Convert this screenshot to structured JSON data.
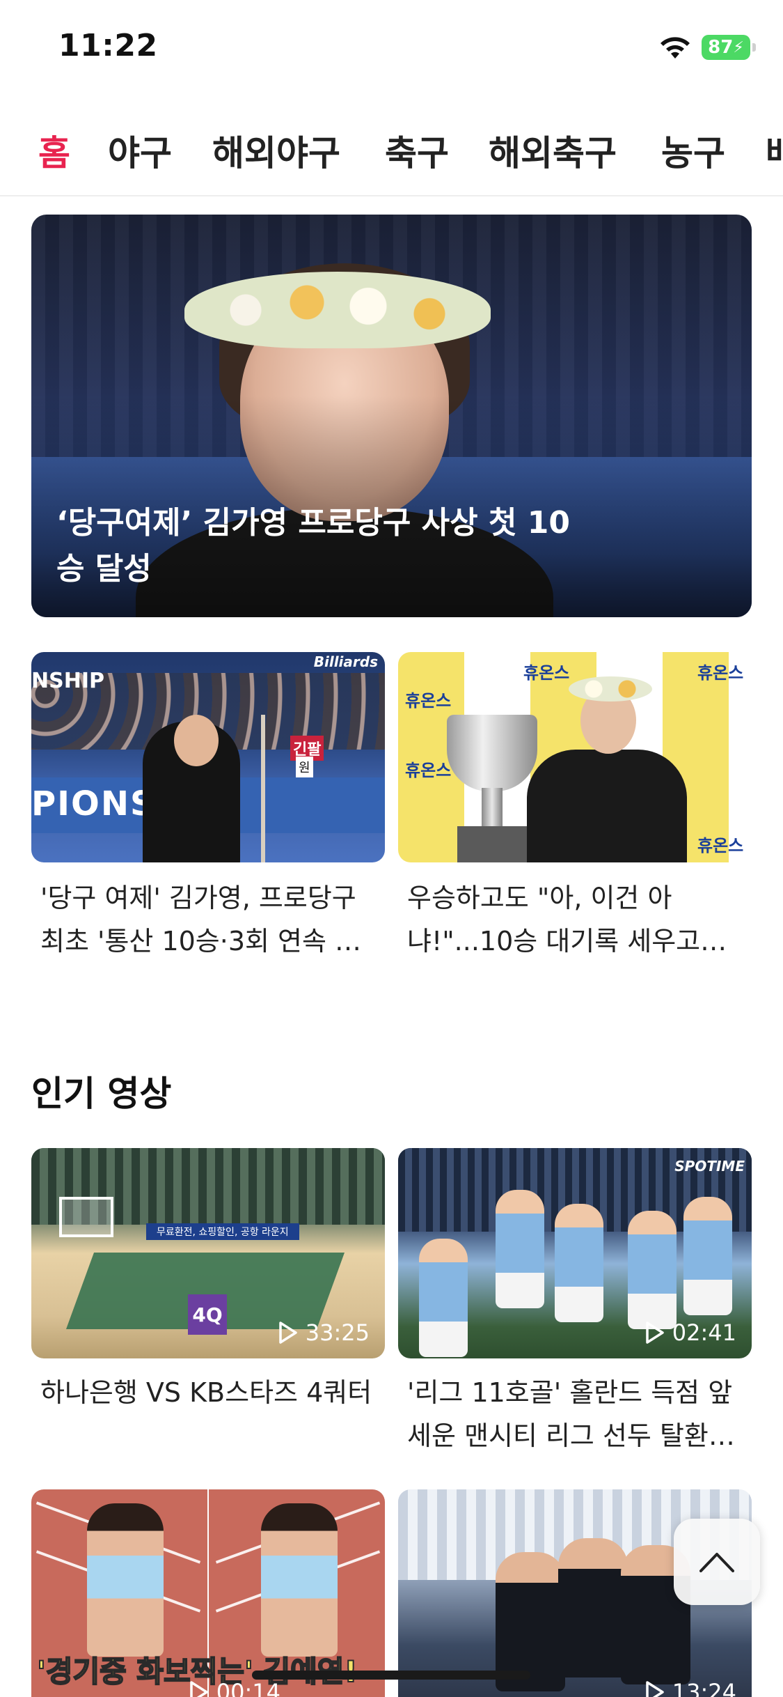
{
  "status_bar": {
    "time": "11:22",
    "battery": "87"
  },
  "tabs": [
    {
      "label": "홈",
      "active": true
    },
    {
      "label": "야구",
      "active": false
    },
    {
      "label": "해외야구",
      "active": false
    },
    {
      "label": "축구",
      "active": false
    },
    {
      "label": "해외축구",
      "active": false
    },
    {
      "label": "농구",
      "active": false
    },
    {
      "label": "배",
      "active": false
    }
  ],
  "colors": {
    "accent": "#e8234f"
  },
  "hero": {
    "title": "‘당구여제’ 김가영 프로당구 사상 첫 10승 달성"
  },
  "news": [
    {
      "title": "'당구 여제' 김가영, 프로당구 최초 '통산 10승·3회 연속 …",
      "thumb_texts": {
        "logo": "Billiards",
        "banner": "PIONSHI",
        "banner_top": "NSHIP",
        "sign": "긴팔",
        "sign2": "원"
      }
    },
    {
      "title": "우승하고도 \"아, 이건 아냐!\"...10승 대기록 세우고…",
      "thumb_texts": {
        "sponsor": "휴온스"
      }
    }
  ],
  "popular_videos": {
    "heading": "인기 영상",
    "items": [
      {
        "title": "하나은행 VS KB스타즈 4쿼터",
        "duration": "33:25",
        "thumb_texts": {
          "quarter": "4Q",
          "ad": "무료환전, 쇼핑할인, 공항 라운지"
        }
      },
      {
        "title": "'리그 11호골' 홀란드 득점 앞세운 맨시티 리그 선두 탈환…",
        "duration": "02:41",
        "thumb_texts": {
          "logo": "SPOTIME"
        }
      },
      {
        "title": "",
        "duration": "00:14",
        "thumb_texts": {
          "caption": "'경기중 화보찍는' 김예연!"
        }
      },
      {
        "title": "",
        "duration": "13:24",
        "thumb_texts": {}
      }
    ]
  },
  "icons": {
    "play": "play-icon",
    "scroll_top": "chevron-up-icon",
    "wifi": "wifi-icon",
    "battery": "battery-icon"
  }
}
